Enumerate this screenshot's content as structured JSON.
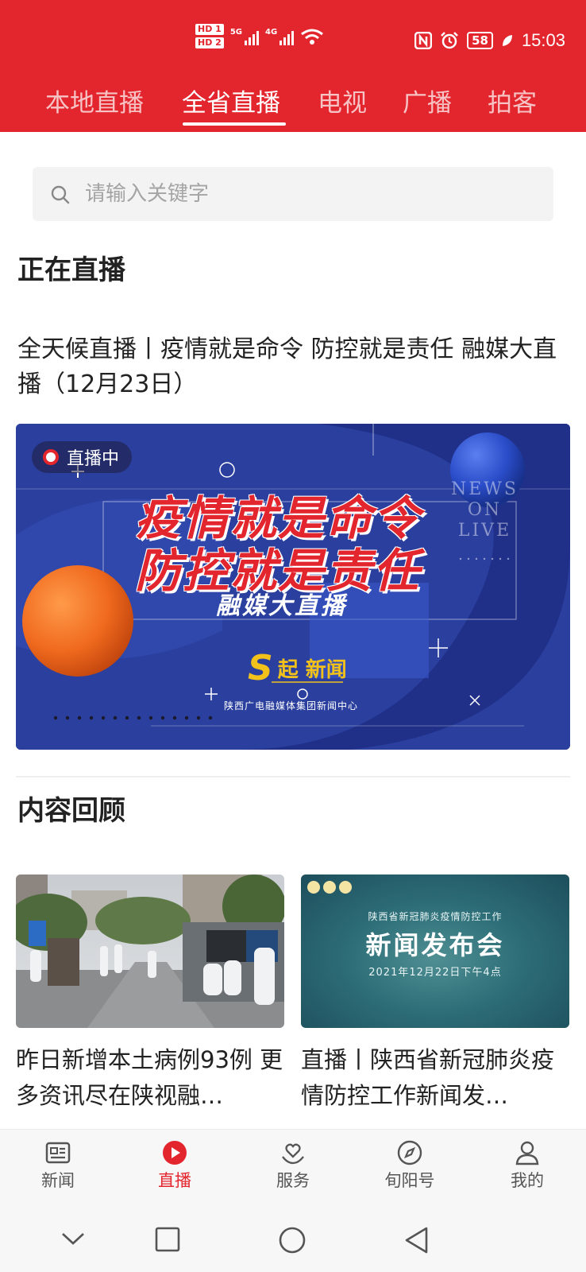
{
  "status_bar": {
    "hd1": "HD 1",
    "hd2": "HD 2",
    "sig1": "5G",
    "sig2": "4G",
    "battery": "58",
    "time": "15:03"
  },
  "top_tabs": [
    {
      "label": "本地直播",
      "active": false
    },
    {
      "label": "全省直播",
      "active": true
    },
    {
      "label": "电视",
      "active": false
    },
    {
      "label": "广播",
      "active": false
    },
    {
      "label": "拍客",
      "active": false
    }
  ],
  "search": {
    "placeholder": "请输入关键字"
  },
  "now_live": {
    "heading": "正在直播",
    "title": "全天候直播丨疫情就是命令 防控就是责任 融媒大直播（12月23日）",
    "badge": "直播中",
    "banner": {
      "line1": "疫情就是命令",
      "line2": "防控就是责任",
      "sub": "融媒大直播",
      "brand_mark": "S",
      "brand_text": "起 新闻",
      "org": "陕西广电融媒体集团新闻中心",
      "onlive": "NEWS\nON\nLIVE"
    }
  },
  "review": {
    "heading": "内容回顾",
    "items": [
      {
        "title": "昨日新增本土病例93例 更多资讯尽在陕视融…"
      },
      {
        "title": "直播丨陕西省新冠肺炎疫情防控工作新闻发…",
        "img_small": "陕西省新冠肺炎疫情防控工作",
        "img_big": "新闻发布会",
        "img_date": "2021年12月22日下午4点"
      }
    ]
  },
  "bottom_nav": [
    {
      "label": "新闻",
      "icon": "news-icon",
      "active": false
    },
    {
      "label": "直播",
      "icon": "live-play-icon",
      "active": true
    },
    {
      "label": "服务",
      "icon": "service-heart-icon",
      "active": false
    },
    {
      "label": "旬阳号",
      "icon": "compass-icon",
      "active": false
    },
    {
      "label": "我的",
      "icon": "user-icon",
      "active": false
    }
  ],
  "colors": {
    "brand_red": "#e3252d",
    "banner_blue": "#2a3f9e",
    "brand_gold": "#f2c21b"
  }
}
